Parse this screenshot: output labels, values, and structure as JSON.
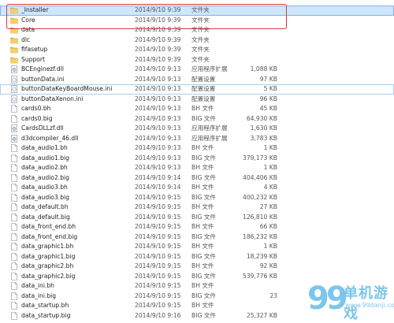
{
  "rows": [
    {
      "name": "_Installer",
      "date": "2014/9/10 9:39",
      "type": "文件夹",
      "size": "",
      "icon": "folder-icon"
    },
    {
      "name": "Core",
      "date": "2014/9/10 9:39",
      "type": "文件夹",
      "size": "",
      "icon": "folder-icon"
    },
    {
      "name": "data",
      "date": "2014/9/10 9:39",
      "type": "文件夹",
      "size": "",
      "icon": "folder-icon"
    },
    {
      "name": "dlc",
      "date": "2014/9/10 9:39",
      "type": "文件夹",
      "size": "",
      "icon": "folder-icon"
    },
    {
      "name": "fifasetup",
      "date": "2014/9/10 9:39",
      "type": "文件夹",
      "size": "",
      "icon": "folder-icon"
    },
    {
      "name": "Support",
      "date": "2014/9/10 9:39",
      "type": "文件夹",
      "size": "",
      "icon": "folder-icon"
    },
    {
      "name": "BCEnginezf.dll",
      "date": "2014/9/10 9:13",
      "type": "应用程序扩展",
      "size": "1,088 KB",
      "icon": "dll-icon"
    },
    {
      "name": "buttonData.ini",
      "date": "2014/9/10 9:13",
      "type": "配置设置",
      "size": "97 KB",
      "icon": "ini-icon"
    },
    {
      "name": "buttonDataKeyBoardMouse.ini",
      "date": "2014/9/10 9:13",
      "type": "配置设置",
      "size": "5 KB",
      "icon": "ini-icon"
    },
    {
      "name": "buttonDataXenon.ini",
      "date": "2014/9/10 9:13",
      "type": "配置设置",
      "size": "96 KB",
      "icon": "ini-icon"
    },
    {
      "name": "cards0.bh",
      "date": "2014/9/10 9:13",
      "type": "BH 文件",
      "size": "45 KB",
      "icon": "file-icon"
    },
    {
      "name": "cards0.big",
      "date": "2014/9/10 9:13",
      "type": "BIG 文件",
      "size": "64,930 KB",
      "icon": "file-icon"
    },
    {
      "name": "CardsDLLzf.dll",
      "date": "2014/9/10 9:13",
      "type": "应用程序扩展",
      "size": "1,630 KB",
      "icon": "dll-icon"
    },
    {
      "name": "d3dcompiler_46.dll",
      "date": "2014/9/10 9:13",
      "type": "应用程序扩展",
      "size": "3,783 KB",
      "icon": "dll-icon"
    },
    {
      "name": "data_audio1.bh",
      "date": "2014/9/10 9:13",
      "type": "BH 文件",
      "size": "1 KB",
      "icon": "file-icon"
    },
    {
      "name": "data_audio1.big",
      "date": "2014/9/10 9:13",
      "type": "BIG 文件",
      "size": "379,173 KB",
      "icon": "file-icon"
    },
    {
      "name": "data_audio2.bh",
      "date": "2014/9/10 9:13",
      "type": "BH 文件",
      "size": "1 KB",
      "icon": "file-icon"
    },
    {
      "name": "data_audio2.big",
      "date": "2014/9/10 9:14",
      "type": "BIG 文件",
      "size": "404,406 KB",
      "icon": "file-icon"
    },
    {
      "name": "data_audio3.bh",
      "date": "2014/9/10 9:14",
      "type": "BH 文件",
      "size": "4 KB",
      "icon": "file-icon"
    },
    {
      "name": "data_audio3.big",
      "date": "2014/9/10 9:15",
      "type": "BIG 文件",
      "size": "400,232 KB",
      "icon": "file-icon"
    },
    {
      "name": "data_default.bh",
      "date": "2014/9/10 9:15",
      "type": "BH 文件",
      "size": "27 KB",
      "icon": "file-icon"
    },
    {
      "name": "data_default.big",
      "date": "2014/9/10 9:15",
      "type": "BIG 文件",
      "size": "126,810 KB",
      "icon": "file-icon"
    },
    {
      "name": "data_front_end.bh",
      "date": "2014/9/10 9:15",
      "type": "BH 文件",
      "size": "66 KB",
      "icon": "file-icon"
    },
    {
      "name": "data_front_end.big",
      "date": "2014/9/10 9:15",
      "type": "BIG 文件",
      "size": "186,232 KB",
      "icon": "file-icon"
    },
    {
      "name": "data_graphic1.bh",
      "date": "2014/9/10 9:15",
      "type": "BH 文件",
      "size": "1 KB",
      "icon": "file-icon"
    },
    {
      "name": "data_graphic1.big",
      "date": "2014/9/10 9:15",
      "type": "BIG 文件",
      "size": "18,239 KB",
      "icon": "file-icon"
    },
    {
      "name": "data_graphic2.bh",
      "date": "2014/9/10 9:15",
      "type": "BH 文件",
      "size": "92 KB",
      "icon": "file-icon"
    },
    {
      "name": "data_graphic2.big",
      "date": "2014/9/10 9:15",
      "type": "BIG 文件",
      "size": "539,776 KB",
      "icon": "file-icon"
    },
    {
      "name": "data_ini.bh",
      "date": "2014/9/10 9:15",
      "type": "BH 文件",
      "size": "",
      "icon": "file-icon"
    },
    {
      "name": "data_ini.big",
      "date": "2014/9/10 9:15",
      "type": "BIG 文件",
      "size": "23",
      "icon": "file-icon"
    },
    {
      "name": "data_startup.bh",
      "date": "2014/9/10 9:15",
      "type": "BH 文件",
      "size": "",
      "icon": "file-icon"
    },
    {
      "name": "data_startup.big",
      "date": "2014/9/10 9:16",
      "type": "BIG 文件",
      "size": "25,327 KB",
      "icon": "file-icon"
    }
  ],
  "watermark": {
    "brand_number": "99",
    "brand_cn": "单机游戏",
    "url": "www.99danji.com"
  },
  "colors": {
    "folder": "#e8b94a",
    "highlight_box": "#d83b3b",
    "selection": "#cfe6fb",
    "watermark": "#7cc6ec"
  }
}
